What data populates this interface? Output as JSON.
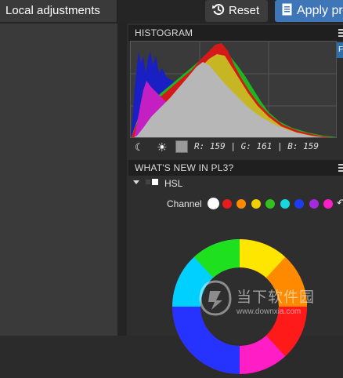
{
  "toolbar": {
    "local_adjustments_label": "Local adjustments",
    "reset_label": "Reset",
    "apply_label": "Apply pr"
  },
  "histogram": {
    "header": "HISTOGRAM",
    "side_tab_label": "F",
    "readout": "R: 159 | G: 161 | B: 159",
    "swatch_color": "#9b9b9b"
  },
  "whats_new": {
    "header": "WHAT'S NEW IN PL3?"
  },
  "hsl": {
    "title": "HSL",
    "channel_label": "Channel",
    "channels": [
      {
        "name": "master",
        "color": "#ffffff",
        "selected": true
      },
      {
        "name": "red",
        "color": "#e81c1c",
        "selected": false
      },
      {
        "name": "orange",
        "color": "#ff8a00",
        "selected": false
      },
      {
        "name": "yellow",
        "color": "#f1cf00",
        "selected": false
      },
      {
        "name": "green",
        "color": "#31c21f",
        "selected": false
      },
      {
        "name": "cyan",
        "color": "#16d9dd",
        "selected": false
      },
      {
        "name": "blue",
        "color": "#1d3cf2",
        "selected": false
      },
      {
        "name": "purple",
        "color": "#a32ae0",
        "selected": false
      },
      {
        "name": "magenta",
        "color": "#ff1ec6",
        "selected": false
      }
    ]
  },
  "watermark": {
    "text": "当下软件园",
    "url": "www.downxia.com"
  },
  "icons": {
    "reset": "reset-icon",
    "apply": "document-icon",
    "menu": "menu-icon",
    "moon": "moon-icon",
    "sun": "sun-icon"
  }
}
